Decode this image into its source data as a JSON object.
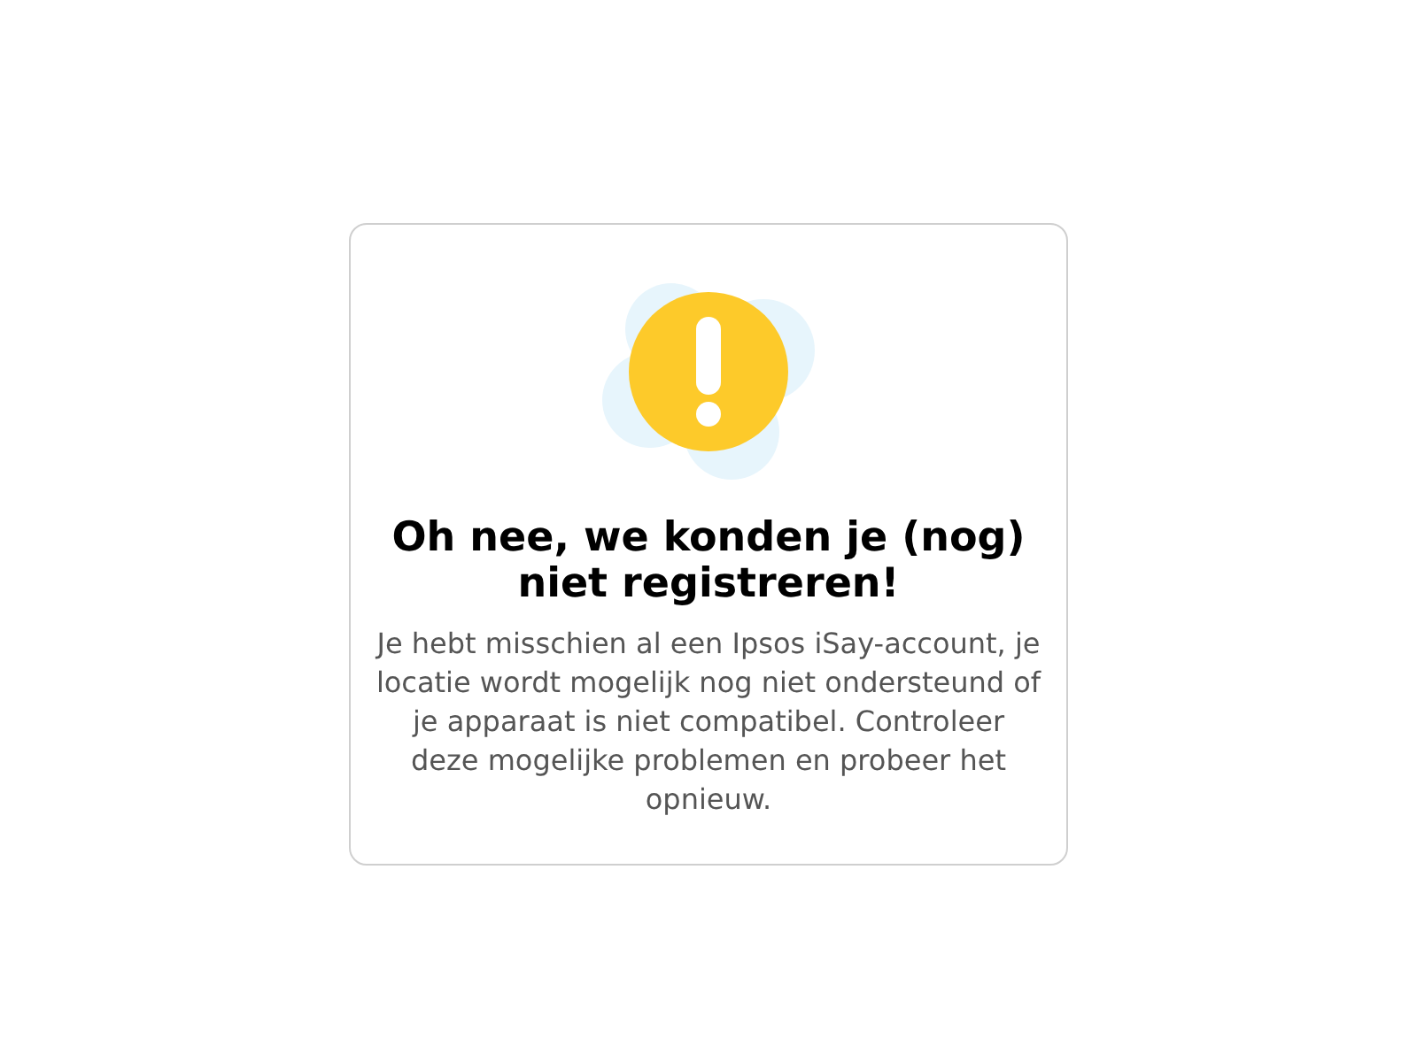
{
  "card": {
    "title": "Oh nee, we konden je (nog) niet registreren!",
    "message": "Je hebt misschien al een Ipsos iSay-account, je locatie wordt mogelijk nog niet ondersteund of je apparaat is niet compatibel. Controleer deze mogelijke problemen en probeer het opnieuw."
  }
}
